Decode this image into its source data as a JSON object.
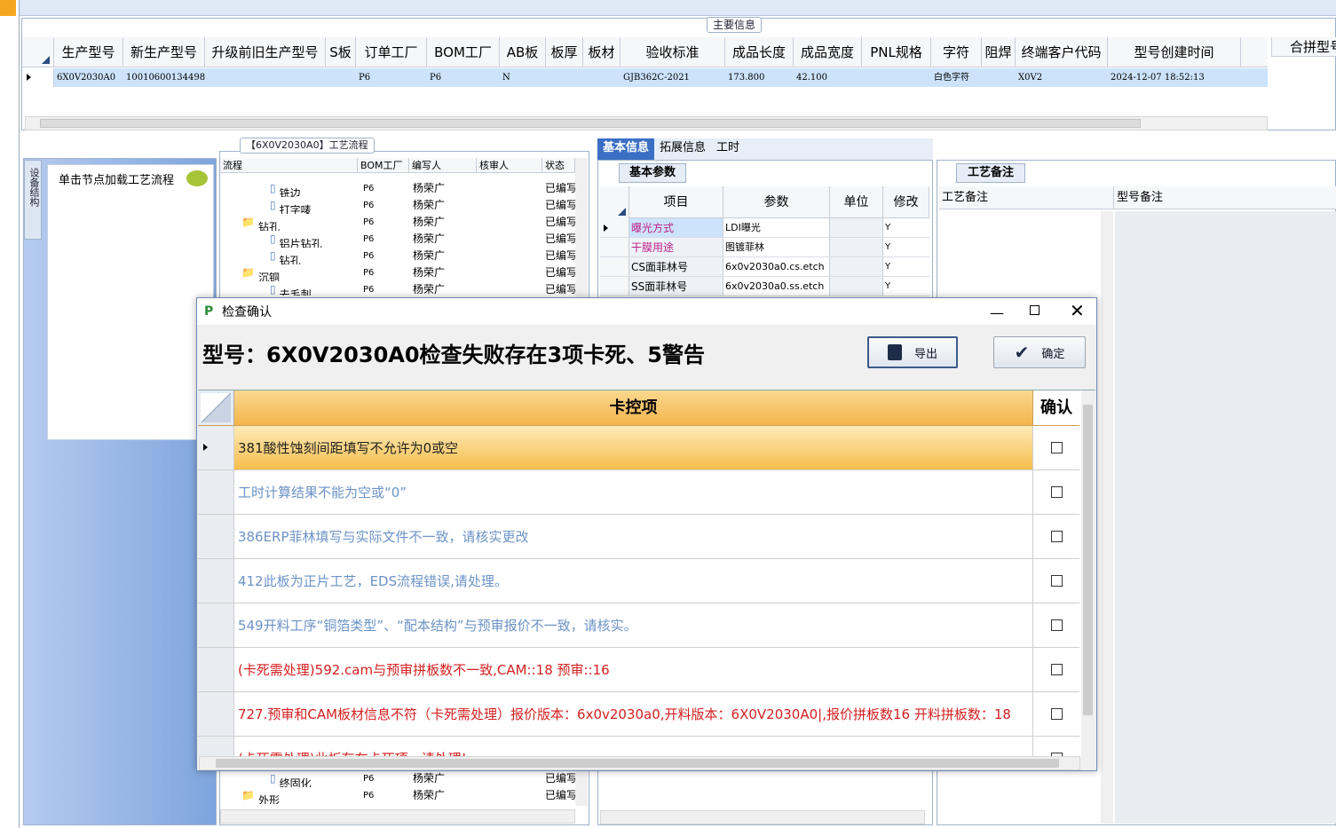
{
  "main": {
    "legend": "主要信息",
    "columns": [
      "生产型号",
      "新生产型号",
      "升级前旧生产型号",
      "S板",
      "订单工厂",
      "BOM工厂",
      "AB板",
      "板厚",
      "板材",
      "验收标准",
      "成品长度",
      "成品宽度",
      "PNL规格",
      "字符",
      "阻焊",
      "终端客户代码",
      "型号创建时间"
    ],
    "row": [
      "6X0V2030A0",
      "10010600134498",
      "",
      "",
      "P6",
      "P6",
      "N",
      "",
      "",
      "GJB362C-2021",
      "173.800",
      "42.100",
      "",
      "白色字符",
      "",
      "X0V2",
      "2024-12-07 18:52:13"
    ],
    "side_header": "合拼型号"
  },
  "left_panel": {
    "vertical_tab": "设备结构",
    "hint": "单击节点加载工艺流程"
  },
  "flow": {
    "title": "【6X0V2030A0】工艺流程",
    "columns": [
      "流程",
      "BOM工厂",
      "编写人",
      "核审人",
      "状态"
    ],
    "rows": [
      {
        "name": "铣边",
        "factory": "P6",
        "writer": "杨荣广",
        "status": "已编写"
      },
      {
        "name": "打字唛",
        "factory": "P6",
        "writer": "杨荣广",
        "status": "已编写"
      },
      {
        "name": "钻孔",
        "factory": "P6",
        "writer": "杨荣广",
        "status": "已编写"
      },
      {
        "name": "铝片钻孔",
        "factory": "P6",
        "writer": "杨荣广",
        "status": "已编写"
      },
      {
        "name": "钻孔",
        "factory": "P6",
        "writer": "杨荣广",
        "status": "已编写"
      },
      {
        "name": "沉铜",
        "factory": "P6",
        "writer": "杨荣广",
        "status": "已编写"
      },
      {
        "name": "去毛刺",
        "factory": "P6",
        "writer": "杨荣广",
        "status": "已编写"
      }
    ],
    "bottom_rows": [
      {
        "name": "终固化",
        "factory": "P6",
        "writer": "杨荣广",
        "status": "已编写"
      },
      {
        "name": "外形",
        "factory": "P6",
        "writer": "杨荣广",
        "status": "已编写"
      }
    ]
  },
  "info": {
    "tabs": [
      "基本信息",
      "拓展信息",
      "工时"
    ],
    "subtab": "基本参数",
    "columns": [
      "项目",
      "参数",
      "单位",
      "修改"
    ],
    "rows": [
      {
        "item": "曝光方式",
        "param": "LDI曝光",
        "unit": "",
        "mod": "Y"
      },
      {
        "item": "干膜用途",
        "param": "图镀菲林",
        "unit": "",
        "mod": "Y"
      },
      {
        "item": "CS面菲林号",
        "param": "6x0v2030a0.cs.etch",
        "unit": "",
        "mod": "Y"
      },
      {
        "item": "SS面菲林号",
        "param": "6x0v2030a0.ss.etch",
        "unit": "",
        "mod": "Y"
      }
    ]
  },
  "remarks": {
    "tab": "工艺备注",
    "col1": "工艺备注",
    "col2": "型号备注"
  },
  "dialog": {
    "title": "检查确认",
    "heading": "型号：6X0V2030A0检查失败存在3项卡死、5警告",
    "export_label": "导出",
    "ok_label": "确定",
    "col_item": "卡控项",
    "col_confirm": "确认",
    "items": [
      {
        "text": "381酸性蚀刻间距填写不允许为0或空",
        "color": "#222222"
      },
      {
        "text": "工时计算结果不能为空或“0”",
        "color": "#6b93c6"
      },
      {
        "text": "386ERP菲林填写与实际文件不一致，请核实更改",
        "color": "#6b93c6"
      },
      {
        "text": "412此板为正片工艺，EDS流程错误,请处理。",
        "color": "#6b93c6"
      },
      {
        "text": "549开料工序“铜箔类型”、“配本结构”与预审报价不一致，请核实。",
        "color": "#6b93c6"
      },
      {
        "text": "(卡死需处理)592.cam与预审拼板数不一致,CAM::18 预审::16",
        "color": "#d42020"
      },
      {
        "text": "727.预审和CAM板材信息不符（卡死需处理）报价版本：6x0v2030a0,开料版本：6X0V2030A0|,报价拼板数16 开料拼板数：18",
        "color": "#d42020"
      },
      {
        "text": "(卡死需处理)此板存在卡死项，请处理!",
        "color": "#d42020"
      }
    ]
  }
}
